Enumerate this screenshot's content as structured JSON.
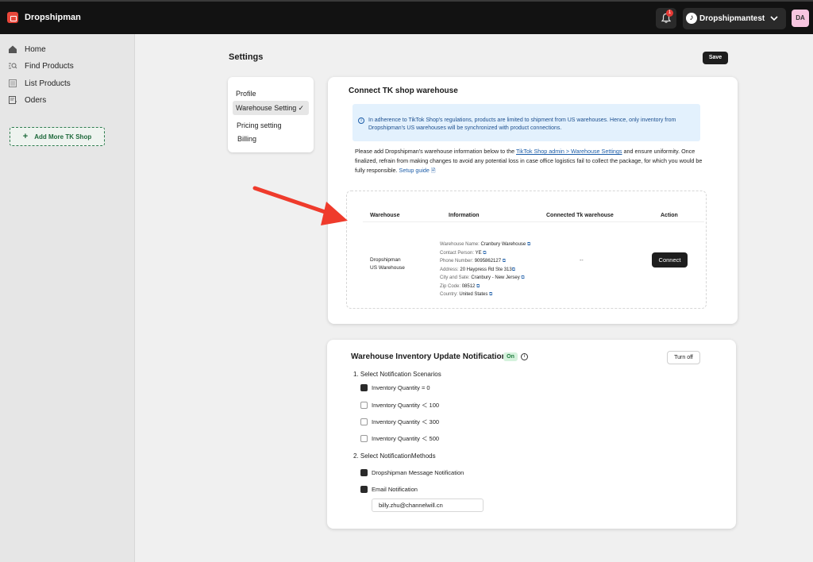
{
  "app": {
    "brand": "Dropshipman",
    "brand_color": "#e8463a"
  },
  "topbar": {
    "notification_count": "1",
    "store_name": "Dropshipmantest",
    "avatar_initials": "DA"
  },
  "sidebar": {
    "items": [
      {
        "label": "Home",
        "icon": "home-icon"
      },
      {
        "label": "Find Products",
        "icon": "search-list-icon"
      },
      {
        "label": "List Products",
        "icon": "list-icon"
      },
      {
        "label": "Oders",
        "icon": "orders-icon"
      }
    ],
    "add_shop_label": "Add More TK Shop"
  },
  "page": {
    "title": "Settings",
    "save_label": "Save"
  },
  "settings_menu": {
    "items": [
      "Profile",
      "Warehouse Setting",
      "Pricing setting",
      "Billing"
    ],
    "active": "Warehouse Setting"
  },
  "warehouse_card": {
    "title": "Connect TK shop warehouse",
    "notice": "In adherence to TikTok Shop's regulations, products are limited to shipment from US warehouses. Hence, only inventory from Dropshipman's US warehouses will be synchronized with product connections.",
    "desc_1": "Please add Dropshipman's warehouse information below to the ",
    "desc_link": "TikTok Shop admin > Warehouse Settings",
    "desc_2": " and ensure uniformity. Once finalized, refrain from making changes to avoid any potential loss in case office logistics fail to collect the package, for which you would be fully responsible.",
    "guide_label": "Setup guide",
    "table": {
      "headers": [
        "Warehouse",
        "Information",
        "Connected Tk warehouse",
        "Action"
      ],
      "row": {
        "warehouse_line1": "Dropshipman",
        "warehouse_line2": "US Warehouse",
        "info": [
          {
            "label": "Warehouse Name: ",
            "value": "Cranbury Warehouse"
          },
          {
            "label": "Contact Person: ",
            "value": "YE"
          },
          {
            "label": "Phone Number: ",
            "value": "9095862127"
          },
          {
            "label": "Address: ",
            "value": "20 Haypress Rd Ste 313"
          },
          {
            "label": "City and Sate: ",
            "value": "Cranbury - New Jersey"
          },
          {
            "label": "Zip Code: ",
            "value": "08512"
          },
          {
            "label": "Country: ",
            "value": "United States"
          }
        ],
        "connected": "--",
        "action_label": "Connect"
      }
    }
  },
  "notification_card": {
    "title": "Warehouse Inventory Update Notification",
    "status_badge": "On",
    "turn_off_label": "Turn off",
    "section1_title": "1. Select Notification Scenarios",
    "scenarios": [
      {
        "label": "Inventory Quantity = 0",
        "checked": true
      },
      {
        "label": "Inventory Quantity ＜ 100",
        "checked": false
      },
      {
        "label": "Inventory Quantity ＜ 300",
        "checked": false
      },
      {
        "label": "Inventory Quantity ＜ 500",
        "checked": false
      }
    ],
    "section2_title": "2. Select NotificationMethods",
    "methods": [
      {
        "label": "Dropshipman Message Notification",
        "checked": true
      },
      {
        "label": "Email Notification",
        "checked": true
      }
    ],
    "email_value": "billy.zhu@channelwill.cn"
  }
}
